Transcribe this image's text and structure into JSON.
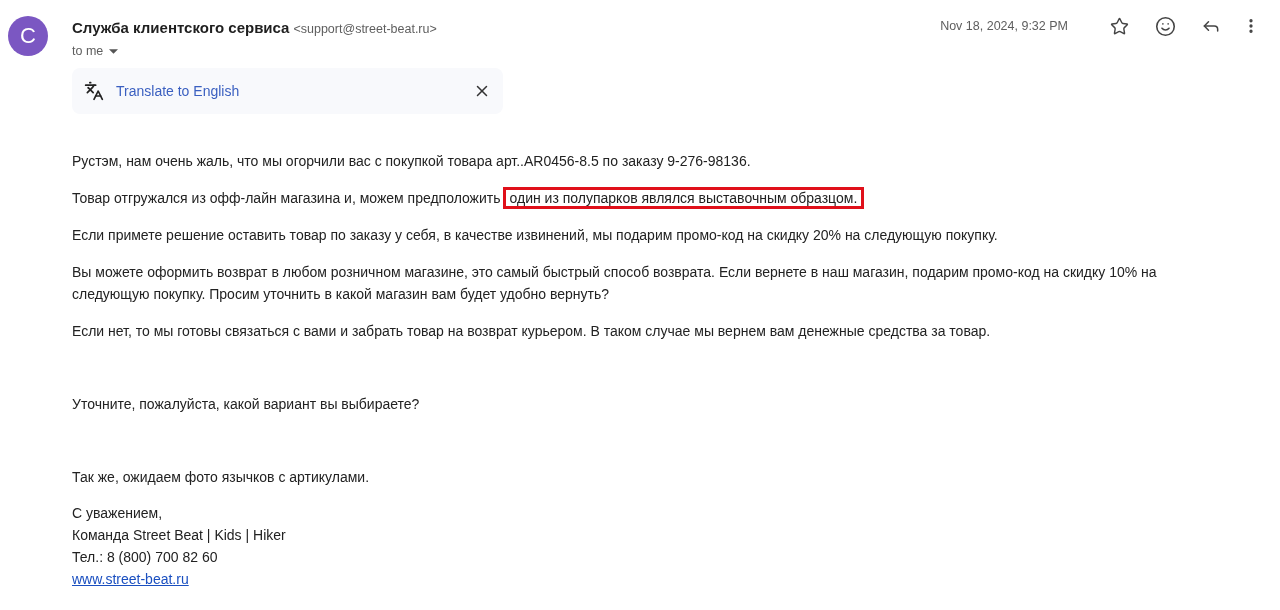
{
  "header": {
    "avatar": "C",
    "sender_name": "Служба клиентского сервиса",
    "sender_email": "<support@street-beat.ru>",
    "recipient": "to me",
    "date": "Nov 18, 2024, 9:32 PM"
  },
  "translate_bar": {
    "label": "Translate to English"
  },
  "body": [
    {
      "kind": "text",
      "text": "Рустэм, нам очень жаль, что мы огорчили вас с покупкой товара арт..AR0456-8.5 по заказу 9-276-98136."
    },
    {
      "kind": "marked",
      "text": "Товар отгружался из офф-лайн магазина и, можем предположить",
      "marked": "один из полупарков являлся выставочным образцом."
    },
    {
      "kind": "text",
      "text": "Если примете решение оставить товар по заказу у себя, в качестве извинений, мы подарим промо-код на скидку 20% на следующую покупку."
    },
    {
      "kind": "text",
      "text": "Вы можете оформить возврат в любом розничном магазине, это самый быстрый способ возврата. Если вернете в наш магазин, подарим промо-код на скидку 10% на следующую покупку. Просим уточнить в какой магазин вам будет удобно вернуть?"
    },
    {
      "kind": "text",
      "text": "Если нет, то мы готовы связаться с вами и забрать товар на возврат курьером. В таком случае мы вернем вам денежные средства за товар."
    }
  ],
  "question": "Уточните, пожалуйста, какой вариант вы выбираете?",
  "request": "Так же, ожидаем фото язычков с артикулами.",
  "signature": [
    {
      "kind": "text",
      "text": "С уважением,"
    },
    {
      "kind": "text",
      "text": "Команда Street Beat | Kids | Hiker"
    },
    {
      "kind": "text",
      "text": "Тел.: 8 (800) 700 82 60"
    },
    {
      "kind": "link",
      "text": "www.street-beat.ru"
    }
  ]
}
